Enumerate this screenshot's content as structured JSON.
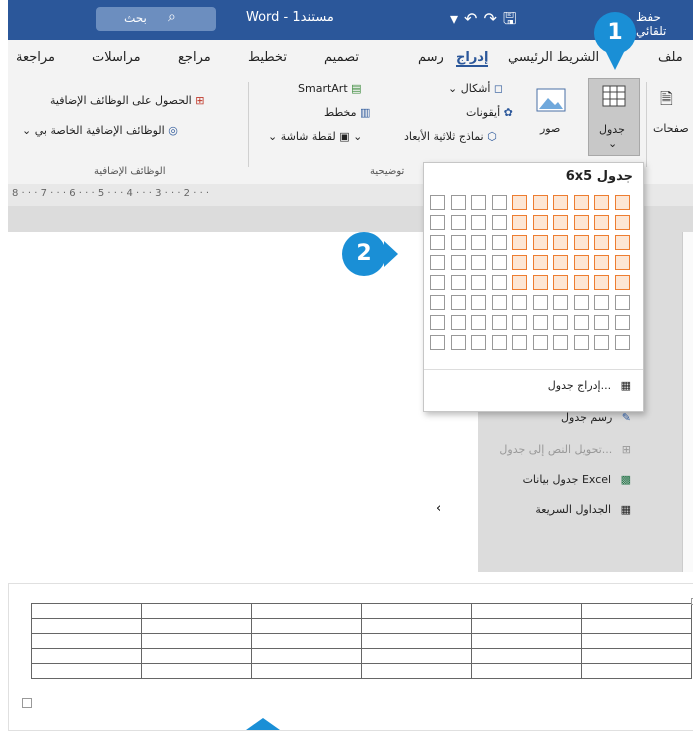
{
  "titlebar": {
    "search_label": "بحث",
    "doc_name": "Word - مستند1",
    "save_label": "حفظ تلقائي"
  },
  "tabs": [
    "ملف",
    "الشريط الرئيسي",
    "إدراج",
    "رسم",
    "تصميم",
    "تخطيط",
    "مراجع",
    "مراسلات",
    "مراجعة"
  ],
  "ribbon": {
    "pages": "صفحات",
    "table": "جدول",
    "pictures": "صور",
    "shapes": "أشكال",
    "icons": "أيقونات",
    "models_3d": "نماذج ثلاثية الأبعاد",
    "smartart": "SmartArt",
    "chart": "مخطط",
    "screenshot": "لقطة شاشة",
    "illustrations_group": "توضيحية",
    "get_addins": "الحصول على الوظائف الإضافية",
    "my_addins": "الوظائف الإضافية الخاصة بي",
    "addins_group": "الوظائف الإضافية"
  },
  "ruler": "8 · · · 7 · · · 6 · · · 5 · · · 4 · · · 3 · · · 2 · · ·",
  "dropdown": {
    "title": "6x5 جدول",
    "grid_cols": 10,
    "grid_rows": 8,
    "highlight_cols": 6,
    "highlight_rows": 5,
    "items": [
      {
        "label": "إدراج جدول...",
        "icon": "insert-table-icon",
        "disabled": false
      },
      {
        "label": "رسم جدول",
        "icon": "draw-table-icon",
        "disabled": false
      },
      {
        "label": "تحويل النص إلى جدول...",
        "icon": "convert-text-icon",
        "disabled": true
      },
      {
        "label": "جدول بيانات Excel",
        "icon": "excel-icon",
        "disabled": false
      },
      {
        "label": "الجداول السريعة",
        "icon": "quick-tables-icon",
        "disabled": false
      }
    ]
  },
  "callouts": [
    "1",
    "2"
  ],
  "result_table": {
    "cols": 6,
    "rows": 5
  },
  "colors": {
    "accent": "#2b579a",
    "highlight": "#ed7d31",
    "callout": "#1a8fd6"
  }
}
